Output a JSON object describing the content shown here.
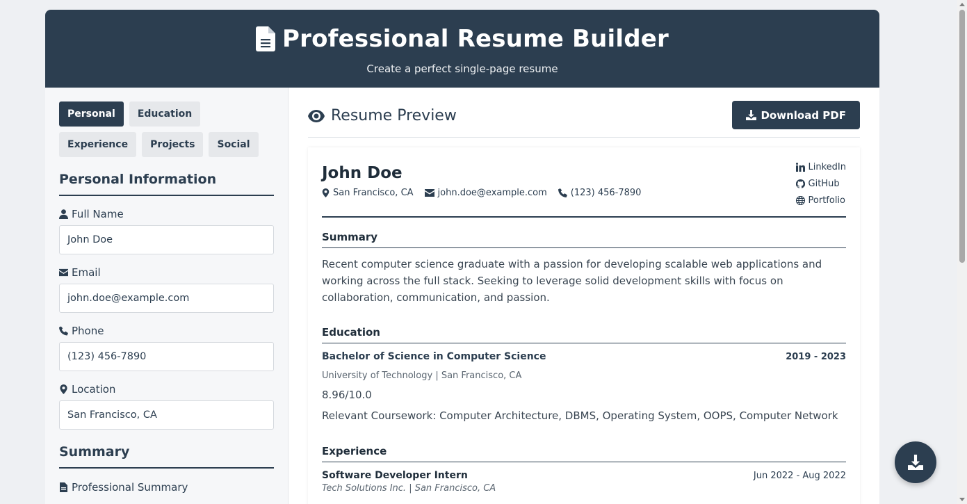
{
  "header": {
    "title": "Professional Resume Builder",
    "subtitle": "Create a perfect single-page resume"
  },
  "tabs": [
    {
      "label": "Personal",
      "active": true
    },
    {
      "label": "Education",
      "active": false
    },
    {
      "label": "Experience",
      "active": false
    },
    {
      "label": "Projects",
      "active": false
    },
    {
      "label": "Social",
      "active": false
    }
  ],
  "form": {
    "section_title": "Personal Information",
    "full_name": {
      "label": "Full Name",
      "value": "John Doe"
    },
    "email": {
      "label": "Email",
      "value": "john.doe@example.com"
    },
    "phone": {
      "label": "Phone",
      "value": "(123) 456-7890"
    },
    "location": {
      "label": "Location",
      "value": "San Francisco, CA"
    },
    "summary_section_title": "Summary",
    "summary_label": "Professional Summary"
  },
  "preview": {
    "title": "Resume Preview",
    "download_label": "Download PDF"
  },
  "resume": {
    "name": "John Doe",
    "location": "San Francisco, CA",
    "email": "john.doe@example.com",
    "phone": "(123) 456-7890",
    "links": {
      "linkedin": "LinkedIn",
      "github": "GitHub",
      "portfolio": "Portfolio"
    },
    "summary_title": "Summary",
    "summary_text": "Recent computer science graduate with a passion for developing scalable web applications and working across the full stack. Seeking to leverage solid development skills with focus on collaboration, communication, and passion.",
    "education_title": "Education",
    "education": {
      "degree": "Bachelor of Science in Computer Science",
      "dates": "2019 - 2023",
      "institution": "University of Technology | San Francisco, CA",
      "gpa": "8.96/10.0",
      "coursework": "Relevant Coursework: Computer Architecture, DBMS, Operating System, OOPS, Computer Network"
    },
    "experience_title": "Experience",
    "experience": {
      "role": "Software Developer Intern",
      "dates": "Jun 2022 - Aug 2022",
      "company": "Tech Solutions Inc. | San Francisco, CA"
    }
  },
  "colors": {
    "primary": "#2c3e50",
    "background": "#eef0f3"
  },
  "icons": [
    "file-icon",
    "eye-icon",
    "download-icon",
    "user-icon",
    "envelope-icon",
    "phone-icon",
    "map-marker-icon",
    "linkedin-icon",
    "github-icon",
    "globe-icon"
  ]
}
